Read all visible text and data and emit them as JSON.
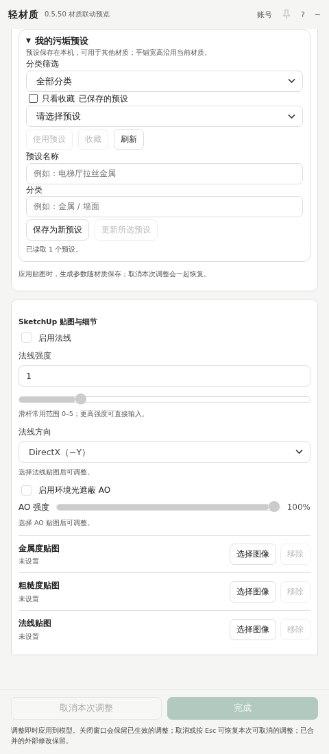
{
  "header": {
    "title": "轻材质",
    "subtitle": "0.5.50 材质联动预览",
    "account": "账号",
    "help": "?",
    "minimize": "−"
  },
  "preset_panel": {
    "title": "我的污垢预设",
    "toggle": "▼",
    "expanded": true,
    "note": "预设保存在本机，可用于其他材质；平铺宽高沿用当前材质。",
    "filter_label": "分类筛选",
    "filter_value": "全部分类",
    "favorites": {
      "label": "只看收藏",
      "checked": false
    },
    "saved_label": "已保存的预设",
    "preset_value": "请选择预设",
    "actions": [
      {
        "label": "使用预设",
        "disabled": true
      },
      {
        "label": "收藏",
        "disabled": true
      },
      {
        "label": "刷新",
        "disabled": false
      }
    ],
    "name_label": "预设名称",
    "name_placeholder": "例如：电梯厅拉丝金属",
    "category_label": "分类",
    "category_placeholder": "例如：金属 / 墙面",
    "save_actions": [
      {
        "label": "保存为新预设",
        "disabled": false
      },
      {
        "label": "更新所选预设",
        "disabled": true
      }
    ],
    "status": "已读取 1 个预设。"
  },
  "panel_note": "应用贴图时，生成参数随材质保存；取消本次调整会一起恢复。",
  "maps_section": {
    "title": "SketchUp 贴图与细节",
    "items": [
      {
        "kind": "checkbox",
        "label": "启用法线",
        "checked": false
      },
      {
        "kind": "label",
        "text": "法线强度"
      },
      {
        "kind": "field",
        "value": "1"
      },
      {
        "kind": "slider",
        "level": 0.2
      },
      {
        "kind": "hint",
        "text": "滑杆常用范围 0–5；更高强度可直接输入。"
      },
      {
        "kind": "label",
        "text": "法线方向"
      },
      {
        "kind": "select",
        "value": "DirectX（−Y）"
      },
      {
        "kind": "hint",
        "text": "选择法线贴图后可调整。"
      },
      {
        "kind": "checkbox",
        "label": "启用环境光遮蔽 AO",
        "checked": false
      },
      {
        "kind": "inline_slider",
        "label": "AO 强度",
        "level": 1,
        "reading": "100%"
      },
      {
        "kind": "hint",
        "text": "选择 AO 贴图后可调整。"
      },
      {
        "kind": "map",
        "title": "金属度贴图",
        "status": "未设置",
        "choose": "选择图像",
        "remove": "移除",
        "remove_disabled": true
      },
      {
        "kind": "map",
        "title": "粗糙度贴图",
        "status": "未设置",
        "choose": "选择图像",
        "remove": "移除",
        "remove_disabled": true
      },
      {
        "kind": "map",
        "title": "法线贴图",
        "status": "未设置",
        "choose": "选择图像",
        "remove": "移除",
        "remove_disabled": true
      }
    ]
  },
  "footer": {
    "cancel": {
      "label": "取消本次调整",
      "disabled": true
    },
    "done": {
      "label": "完成",
      "disabled": true
    },
    "note": "调整即时应用到模型。关闭窗口会保留已生效的调整；取消或按 Esc 可恢复本次可取消的调整；已合并的外部修改保留。"
  }
}
